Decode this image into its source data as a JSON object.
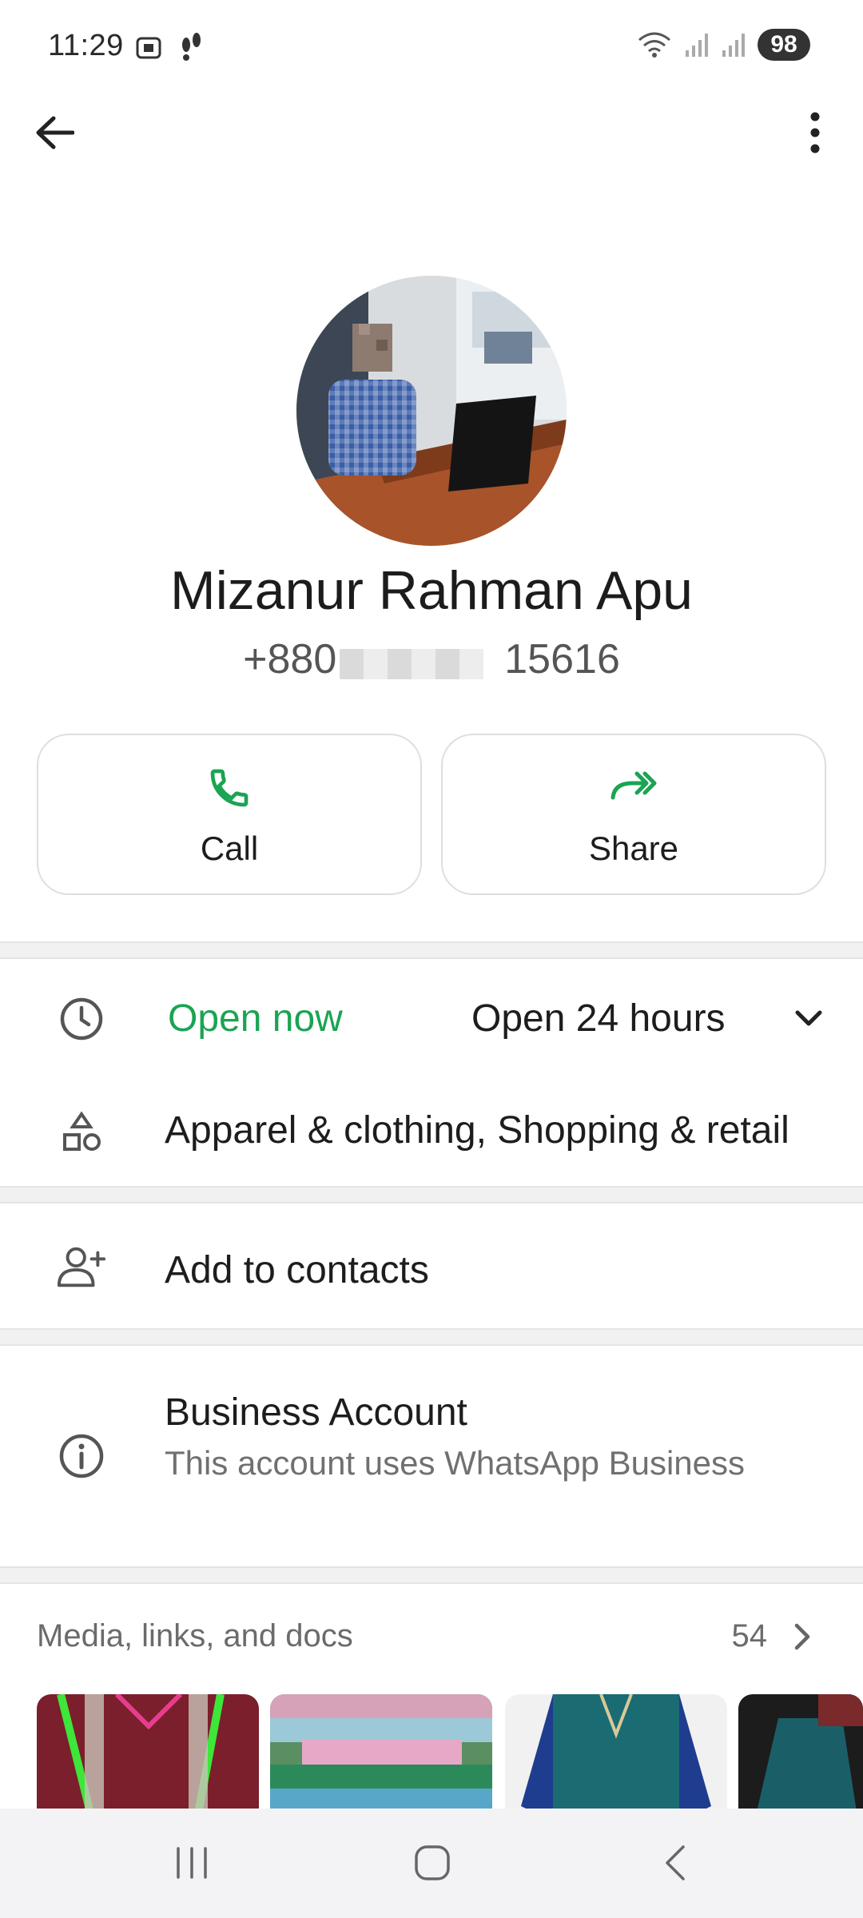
{
  "status_bar": {
    "time": "11:29",
    "battery": "98",
    "icons_left": [
      "screenshot-icon",
      "footsteps-icon"
    ],
    "icons_right": [
      "wifi-icon",
      "signal-icon",
      "signal-icon"
    ]
  },
  "toolbar": {
    "back_icon": "back-arrow-icon",
    "menu_icon": "more-vert-icon"
  },
  "profile": {
    "name": "Mizanur Rahman Apu",
    "phone_prefix": "+880",
    "phone_suffix": "15616"
  },
  "actions": [
    {
      "label": "Call",
      "icon": "phone-icon"
    },
    {
      "label": "Share",
      "icon": "forward-icon"
    }
  ],
  "business_hours": {
    "status": "Open now",
    "hours": "Open 24 hours"
  },
  "category": "Apparel & clothing, Shopping & retail",
  "add_contact": "Add to contacts",
  "business_account": {
    "title": "Business Account",
    "subtitle": "This account uses WhatsApp Business"
  },
  "media": {
    "title": "Media, links, and docs",
    "count": "54"
  },
  "colors": {
    "accent_green": "#1aa453",
    "text_primary": "#1d1d1d",
    "text_secondary": "#707070"
  }
}
